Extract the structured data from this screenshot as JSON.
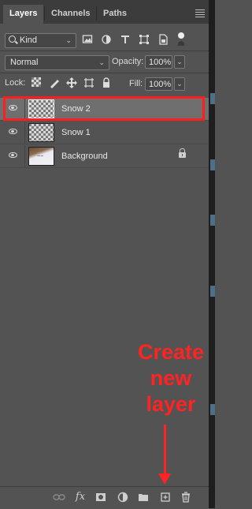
{
  "tabs": [
    {
      "label": "Layers",
      "active": true
    },
    {
      "label": "Channels",
      "active": false
    },
    {
      "label": "Paths",
      "active": false
    }
  ],
  "filter": {
    "kind_label": "Kind",
    "icons": [
      "image-filter-icon",
      "adjustment-filter-icon",
      "type-filter-icon",
      "shape-filter-icon",
      "smart-object-filter-icon"
    ]
  },
  "blend": {
    "mode": "Normal",
    "opacity_label": "Opacity:",
    "opacity_value": "100%"
  },
  "lock": {
    "label": "Lock:",
    "fill_label": "Fill:",
    "fill_value": "100%"
  },
  "layers": [
    {
      "name": "Snow 2",
      "selected": true,
      "visible": true,
      "locked": false
    },
    {
      "name": "Snow 1",
      "selected": false,
      "visible": true,
      "locked": false
    },
    {
      "name": "Background",
      "selected": false,
      "visible": true,
      "locked": true
    }
  ],
  "annotation": {
    "line1": "Create",
    "line2": "new",
    "line3": "layer",
    "color": "#ff2323"
  },
  "highlight_color": "#ff1d1d",
  "footer": {
    "fx_label": "fx",
    "icons": [
      "link-layers-icon",
      "fx-icon",
      "add-mask-icon",
      "adjustment-layer-icon",
      "new-group-icon",
      "new-layer-icon",
      "delete-layer-icon"
    ]
  }
}
